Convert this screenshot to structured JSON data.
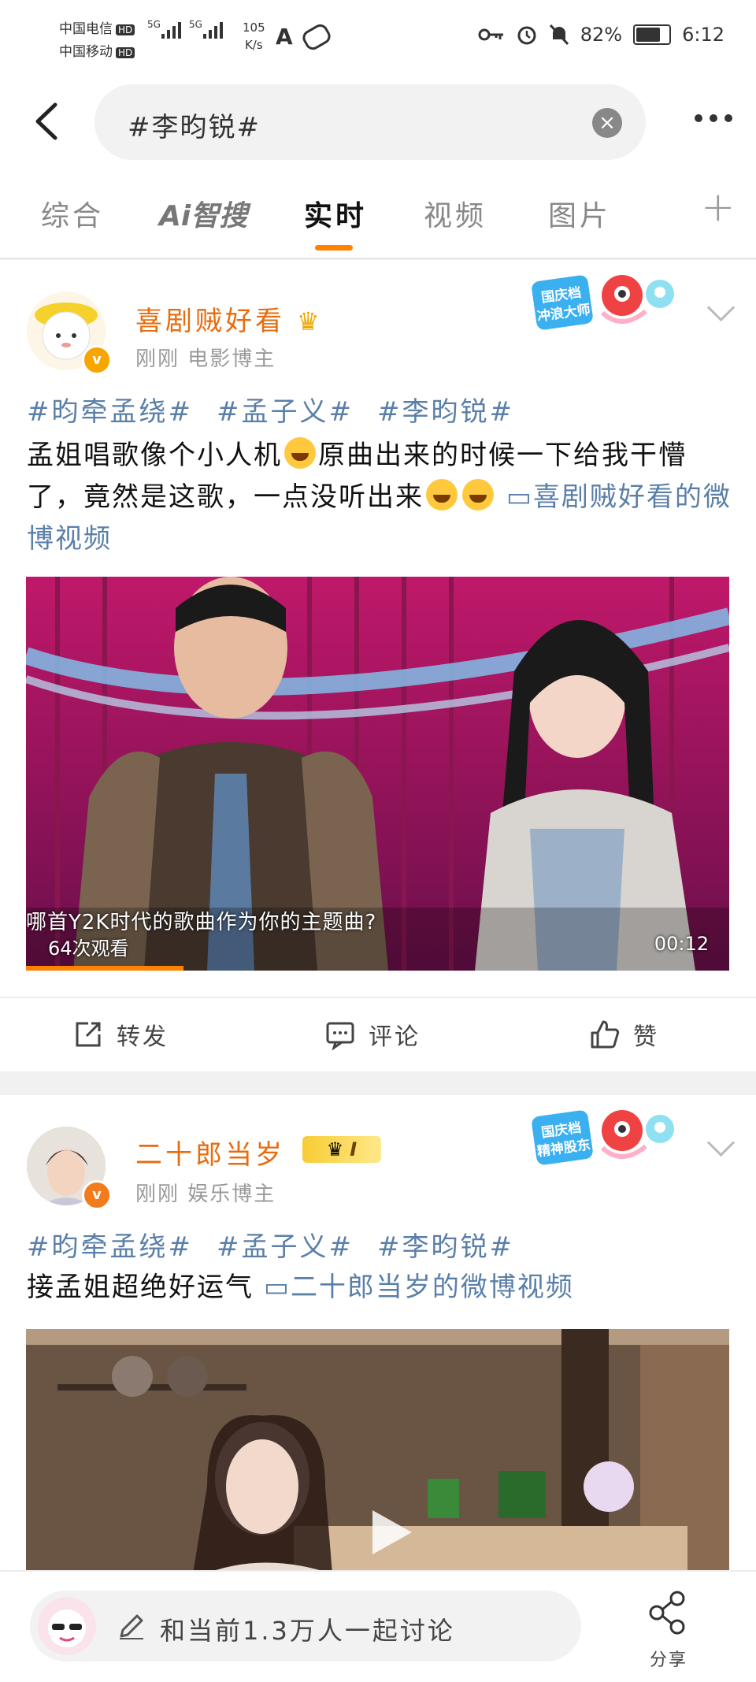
{
  "status_bar": {
    "carrier_1": "中国电信",
    "carrier_2": "中国移动",
    "hd": "HD",
    "net_1": "5G",
    "net_2": "5G",
    "net_speed_value": "105",
    "net_speed_unit": "K/s",
    "battery": "82%",
    "battery_level": 0.82,
    "time": "6:12"
  },
  "search": {
    "query": "#李昀锐#",
    "clear_icon": "close-icon",
    "back_icon": "chevron-left-icon",
    "more_icon": "more-horizontal-icon"
  },
  "tabs": [
    {
      "label": "综合"
    },
    {
      "label": "Ai智搜"
    },
    {
      "label": "实时",
      "active": true
    },
    {
      "label": "视频"
    },
    {
      "label": "图片"
    }
  ],
  "posts": [
    {
      "username": "喜剧贼好看",
      "meta": "刚刚  电影博主",
      "stamp": "国庆档冲浪大师",
      "tags": [
        "#昀牵孟绕#",
        "#孟子义#",
        "#李昀锐#"
      ],
      "text_1": "孟姐唱歌像个小人机",
      "text_2": "原曲出来的时候一下给我干懵了，竟然是这歌，一点没听出来",
      "video_link": "喜剧贼好看的微博视频",
      "video": {
        "caption": "哪首Y2K时代的歌曲作为你的主题曲?",
        "views": "64次观看",
        "duration": "00:12"
      },
      "actions": {
        "repost": "转发",
        "comment": "评论",
        "like": "赞"
      }
    },
    {
      "username": "二十郎当岁",
      "meta": "刚刚  娱乐博主",
      "stamp": "国庆档精神股东",
      "level_badge": "I",
      "tags": [
        "#昀牵孟绕#",
        "#孟子义#",
        "#李昀锐#"
      ],
      "text": "接孟姐超绝好运气",
      "video_link": "二十郎当岁的微博视频"
    }
  ],
  "bottom_bar": {
    "discuss_placeholder": "和当前1.3万人一起讨论",
    "share_label": "分享"
  },
  "colors": {
    "accent": "#ff8200",
    "link": "#5a7fa8",
    "username": "#e86c0d"
  }
}
